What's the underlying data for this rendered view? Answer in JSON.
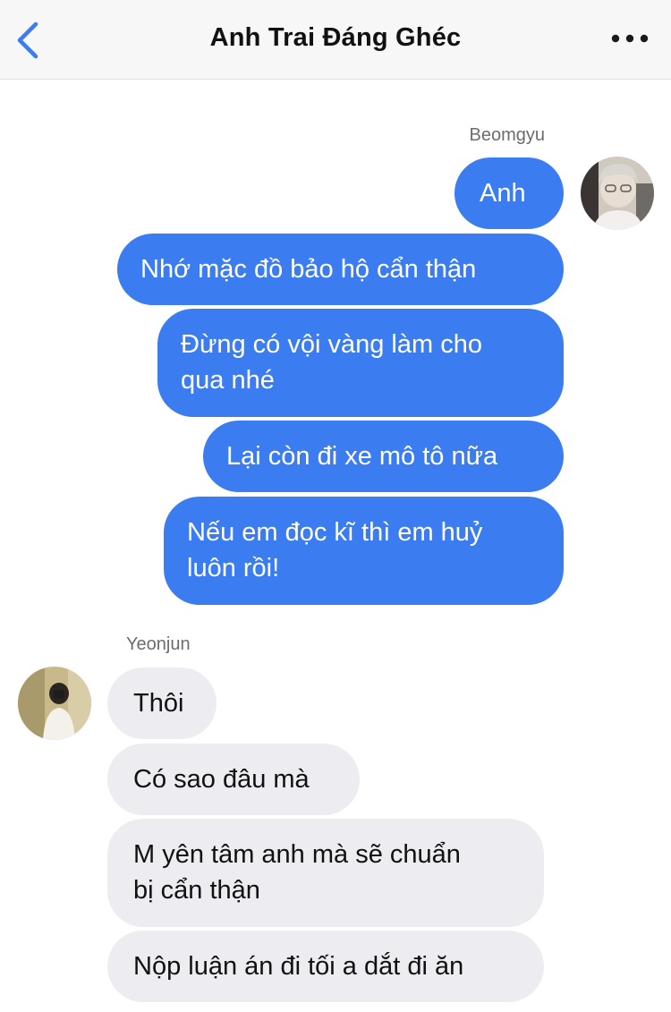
{
  "header": {
    "title": "Anh Trai Đáng Ghéc",
    "back_icon": "chevron-left-icon",
    "more_icon": "more-dots-icon",
    "accent_color": "#3b7cf0"
  },
  "conversation": {
    "outgoing": {
      "sender": "Beomgyu",
      "bubble_color": "#3b7cf0",
      "messages": [
        "Anh",
        "Nhớ mặc đồ bảo hộ cẩn thận",
        "Đừng có vội vàng làm cho\nqua nhé",
        "Lại còn đi xe mô tô nữa",
        "Nếu em đọc kĩ thì em huỷ\nluôn rồi!"
      ]
    },
    "incoming": {
      "sender": "Yeonjun",
      "bubble_color": "#ededf1",
      "messages": [
        "Thôi",
        "Có sao đâu mà",
        "M yên tâm anh mà sẽ chuẩn\nbị cẩn thận",
        "Nộp luận án đi tối a dắt đi ăn"
      ]
    }
  }
}
